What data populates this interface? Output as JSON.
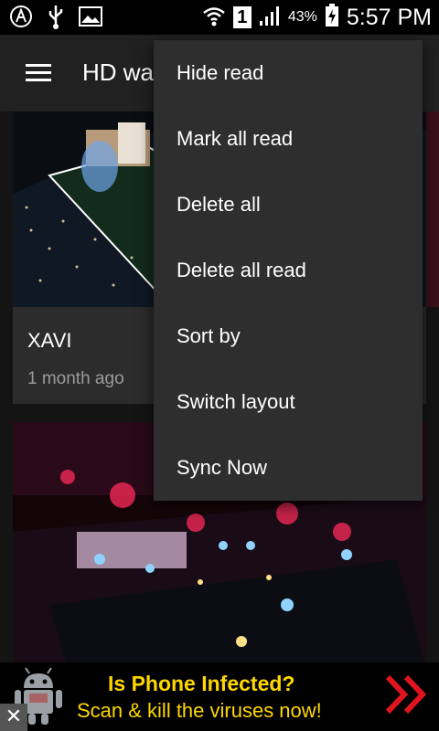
{
  "status_bar": {
    "battery_percent": "43%",
    "sim_slot": "1",
    "time": "5:57 PM",
    "icons": [
      "app-notification-icon",
      "usb-icon",
      "image-icon",
      "wifi-icon",
      "sim-icon",
      "signal-icon",
      "battery-icon"
    ]
  },
  "toolbar": {
    "title": "HD wa"
  },
  "feed": {
    "cards": [
      {
        "title": "XAVI",
        "time": "1 month ago"
      }
    ]
  },
  "overflow_menu": {
    "items": [
      {
        "label": "Hide read"
      },
      {
        "label": "Mark all read"
      },
      {
        "label": "Delete all"
      },
      {
        "label": "Delete all read"
      },
      {
        "label": "Sort by"
      },
      {
        "label": "Switch layout"
      },
      {
        "label": "Sync Now"
      }
    ]
  },
  "ad": {
    "line1": "Is Phone Infected?",
    "line2": "Scan & kill the viruses now!",
    "close_label": "✕",
    "accent_color": "#ffd700",
    "arrow_color": "#e0141e"
  }
}
